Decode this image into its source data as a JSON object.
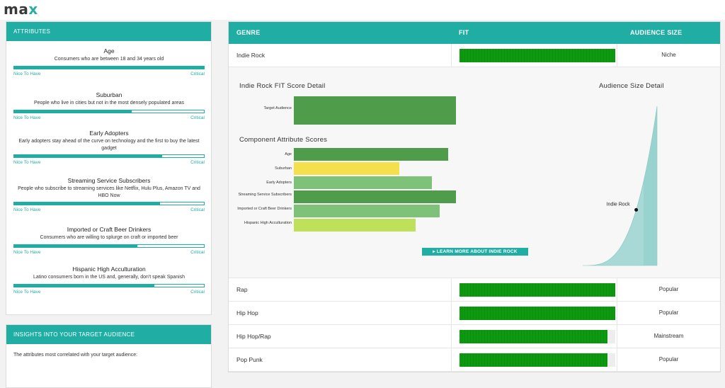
{
  "app": {
    "logo_main": "ma",
    "logo_accent": "x"
  },
  "attributes_panel": {
    "title": "ATTRIBUTES",
    "items": [
      {
        "title": "Age",
        "desc": "Consumers who are between 18 and 34 years old",
        "low": "Nice To Have",
        "high": "Critical",
        "importance": 1.0
      },
      {
        "title": "Suburban",
        "desc": "People who live in cities but not in the most densely populated areas",
        "low": "Nice To Have",
        "high": "Critical",
        "importance": 0.62
      },
      {
        "title": "Early Adopters",
        "desc": "Early adopters stay ahead of the curve on technology and the first to buy the latest gadget",
        "low": "Nice To Have",
        "high": "Critical",
        "importance": 0.78
      },
      {
        "title": "Streaming Service Subscribers",
        "desc": "People who subscribe to streaming services like Netflix, Hulu Plus, Amazon TV and HBO Now",
        "low": "Nice To Have",
        "high": "Critical",
        "importance": 0.77
      },
      {
        "title": "Imported or Craft Beer Drinkers",
        "desc": "Consumers who are willing to splurge on craft or imported beer",
        "low": "Nice To Have",
        "high": "Critical",
        "importance": 0.65
      },
      {
        "title": "Hispanic High Acculturation",
        "desc": "Latino consumers born in the US and, generally, don't speak Spanish",
        "low": "Nice To Have",
        "high": "Critical",
        "importance": 0.74
      }
    ]
  },
  "insights_panel": {
    "title": "INSIGHTS INTO YOUR TARGET AUDIENCE",
    "body": "The attributes most correlated with your target audience:"
  },
  "table": {
    "headers": {
      "genre": "GENRE",
      "fit": "FIT",
      "audience": "AUDIENCE SIZE"
    },
    "expanded_row": {
      "genre": "Indie Rock",
      "fit": 1.0,
      "audience": "Niche"
    },
    "rows": [
      {
        "genre": "Rap",
        "fit": 1.0,
        "audience": "Popular"
      },
      {
        "genre": "Hip Hop",
        "fit": 1.0,
        "audience": "Popular"
      },
      {
        "genre": "Hip Hop/Rap",
        "fit": 0.95,
        "audience": "Mainstream"
      },
      {
        "genre": "Pop Punk",
        "fit": 0.95,
        "audience": "Popular"
      }
    ]
  },
  "detail": {
    "fit_title": "Indie Rock FIT Score Detail",
    "components_title": "Component Attribute Scores",
    "audience_title": "Audience Size Detail",
    "learn_more": "▸ LEARN MORE ABOUT INDIE ROCK",
    "curve_point_label": "Indie Rock",
    "colors": {
      "dark_green": "#4f9d4b",
      "yellow": "#f4e04d",
      "light_green": "#7ec27a",
      "lime": "#bfe05a",
      "teal": "#20ada3",
      "curve": "#a8d9d6"
    }
  },
  "chart_data": [
    {
      "type": "bar",
      "orientation": "horizontal",
      "title": "Indie Rock FIT Score Detail",
      "categories": [
        "Target Audience"
      ],
      "values": [
        1.0
      ],
      "colors": [
        "#4f9d4b"
      ]
    },
    {
      "type": "bar",
      "orientation": "horizontal",
      "title": "Component Attribute Scores",
      "categories": [
        "Age",
        "Suburban",
        "Early Adopters",
        "Streaming Service Subscribers",
        "Imported or Craft Beer Drinkers",
        "Hispanic High Acculturation"
      ],
      "values": [
        0.95,
        0.65,
        0.85,
        1.0,
        0.9,
        0.75
      ],
      "colors": [
        "#4f9d4b",
        "#f4e04d",
        "#7ec27a",
        "#4f9d4b",
        "#7ec27a",
        "#bfe05a"
      ]
    },
    {
      "type": "area",
      "title": "Audience Size Detail",
      "annotation": "Indie Rock",
      "marker_position": 0.72
    }
  ]
}
